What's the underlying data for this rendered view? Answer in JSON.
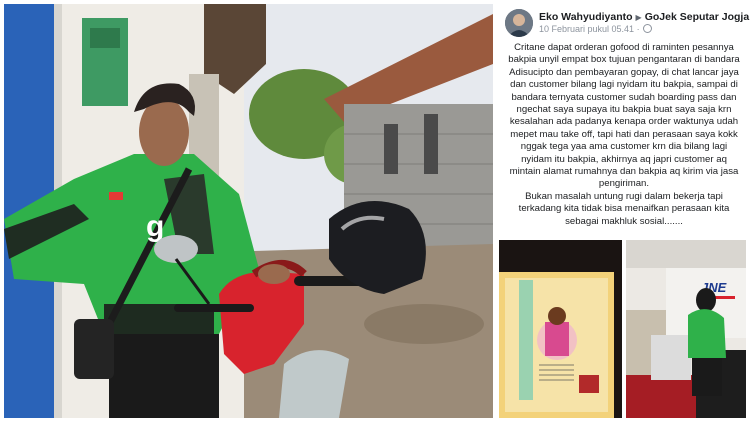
{
  "post": {
    "author": "Eko Wahyudiyanto",
    "group": "GoJek Seputar Jogja",
    "timestamp": "10 Februari pukul 05.41 ·",
    "body_paragraph_1": "Critane dapat orderan gofood di raminten pesannya bakpia unyil empat box tujuan pengantaran di bandara Adisucipto dan pembayaran gopay, di chat lancar jaya dan customer bilang lagi nyidam itu bakpia, sampai di bandara ternyata customer sudah boarding pass dan ngechat saya supaya itu bakpia buat saya saja krn kesalahan ada padanya kenapa order waktunya udah mepet mau take off, tapi hati dan perasaan saya kokk nggak tega yaa ama customer krn dia bilang lagi nyidam itu bakpia, akhirnya aq japri customer aq mintain alamat rumahnya dan bakpia aq kirim via jasa pengiriman.",
    "body_paragraph_2": "Bukan masalah untung rugi dalam bekerja tapi terkadang kita tidak bisa menaifkan perasaan kita sebagai makhluk sosial......."
  },
  "photos": {
    "main_alt": "Driver in green jacket with red scooter",
    "box_label": "Bakpia",
    "shop_sign": "JNE"
  },
  "colors": {
    "jacket_green": "#2fb14a",
    "scooter_red": "#d8232d",
    "jne_blue": "#1d3b8f"
  }
}
